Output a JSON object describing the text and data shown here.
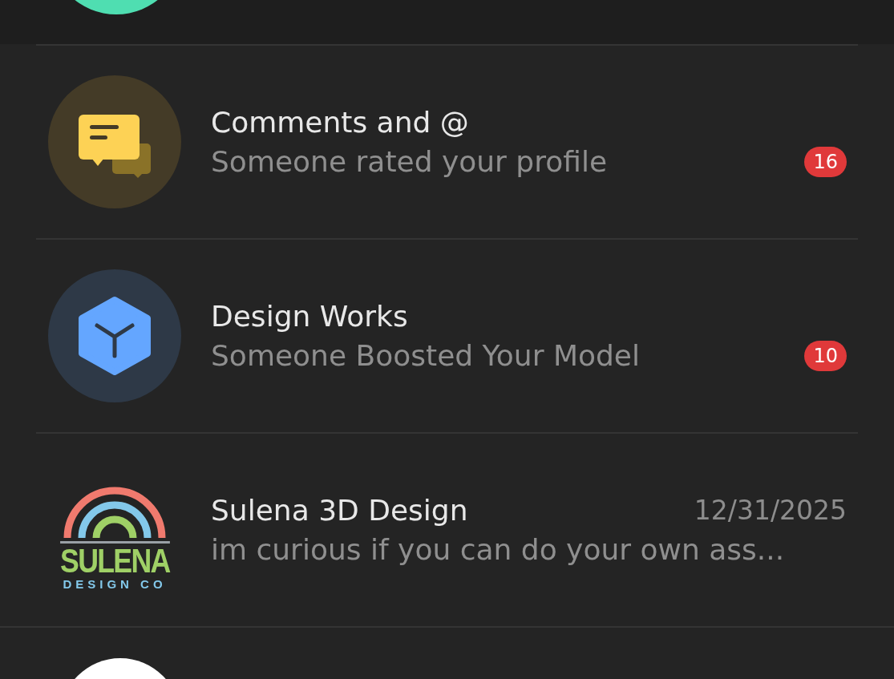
{
  "conversations": [
    {
      "kind": "comments",
      "title": "Comments and @",
      "preview": "Someone rated your profile",
      "badge": "16"
    },
    {
      "kind": "cube",
      "title": "Design Works",
      "preview": "Someone Boosted Your Model",
      "badge": "10"
    },
    {
      "kind": "logo",
      "logo_name": "SULENA",
      "logo_tagline": "DESIGN CO",
      "title": "Sulena 3D Design",
      "preview": "im curious if you can do your own ass...",
      "date": "12/31/2025"
    }
  ]
}
